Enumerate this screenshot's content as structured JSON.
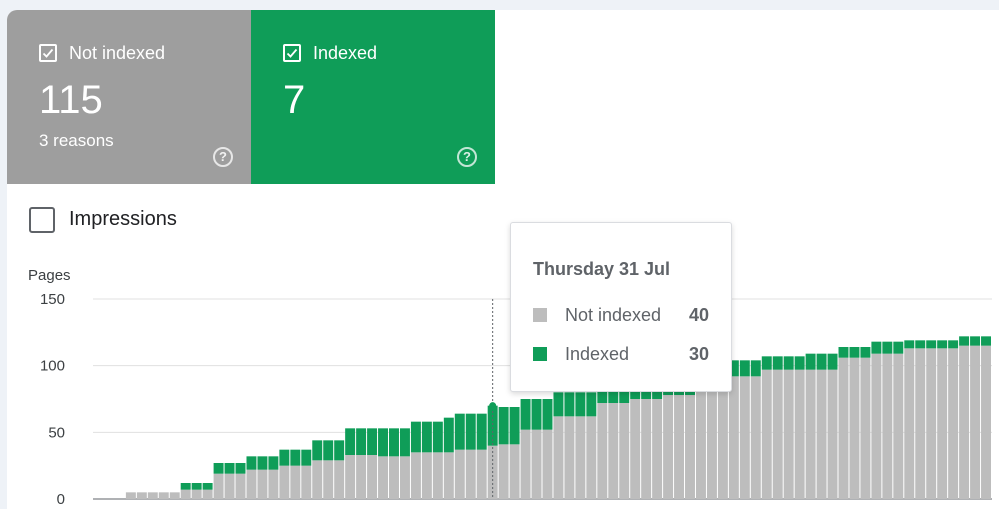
{
  "tiles": [
    {
      "label": "Not indexed",
      "value": "115",
      "sub": "3 reasons",
      "help": "?"
    },
    {
      "label": "Indexed",
      "value": "7",
      "help": "?"
    }
  ],
  "impressions_label": "Impressions",
  "tooltip": {
    "date": "Thursday 31 Jul",
    "rows": [
      {
        "name": "Not indexed",
        "value": "40"
      },
      {
        "name": "Indexed",
        "value": "30"
      }
    ]
  },
  "colors": {
    "not_indexed": "#bdbdbd",
    "indexed": "#0f9d58",
    "grid": "#e0e0e0",
    "axis": "#5f6368"
  },
  "chart_data": {
    "type": "bar",
    "stacked": true,
    "ylabel": "Pages",
    "ylim": [
      0,
      150
    ],
    "yticks": [
      "150",
      "100",
      "50",
      "0"
    ],
    "grid": true,
    "highlight_index": 36,
    "series": [
      {
        "name": "Not indexed",
        "values": [
          0,
          0,
          0,
          5,
          5,
          5,
          5,
          5,
          7,
          7,
          7,
          19,
          19,
          19,
          22,
          22,
          22,
          25,
          25,
          25,
          29,
          29,
          29,
          33,
          33,
          33,
          32,
          32,
          32,
          35,
          35,
          35,
          35,
          37,
          37,
          37,
          40,
          41,
          41,
          52,
          52,
          52,
          62,
          62,
          62,
          62,
          72,
          72,
          72,
          75,
          75,
          75,
          78,
          78,
          78,
          84,
          84,
          84,
          92,
          92,
          92,
          97,
          97,
          97,
          97,
          97,
          97,
          97,
          106,
          106,
          106,
          109,
          109,
          109,
          113,
          113,
          113,
          113,
          113,
          115,
          115,
          115
        ]
      },
      {
        "name": "Indexed",
        "values": [
          0,
          0,
          0,
          0,
          0,
          0,
          0,
          0,
          5,
          5,
          5,
          8,
          8,
          8,
          10,
          10,
          10,
          12,
          12,
          12,
          15,
          15,
          15,
          20,
          20,
          20,
          21,
          21,
          21,
          23,
          23,
          23,
          26,
          27,
          27,
          27,
          30,
          28,
          28,
          23,
          23,
          23,
          18,
          18,
          18,
          18,
          12,
          12,
          12,
          9,
          9,
          9,
          9,
          9,
          9,
          8,
          8,
          8,
          12,
          12,
          12,
          10,
          10,
          10,
          10,
          12,
          12,
          12,
          8,
          8,
          8,
          9,
          9,
          9,
          6,
          6,
          6,
          6,
          6,
          7,
          7,
          7
        ]
      }
    ]
  }
}
